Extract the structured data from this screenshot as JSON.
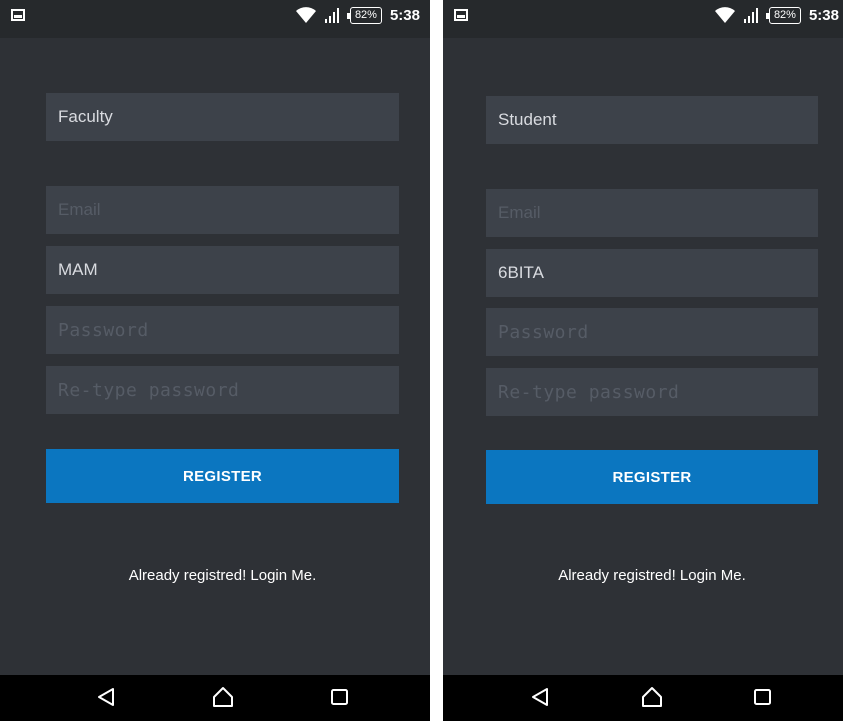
{
  "status_bar": {
    "battery": "82%",
    "time": "5:38"
  },
  "screens": [
    {
      "role_value": "Faculty",
      "email_placeholder": "Email",
      "name_value": "MAM",
      "password_placeholder": "Password",
      "retype_placeholder": "Re-type password",
      "register_label": "REGISTER",
      "login_link": "Already registred! Login Me."
    },
    {
      "role_value": "Student",
      "email_placeholder": "Email",
      "name_value": "6BITA",
      "password_placeholder": "Password",
      "retype_placeholder": "Re-type password",
      "register_label": "REGISTER",
      "login_link": "Already registred! Login Me."
    }
  ],
  "icons": {
    "status": [
      "image-notification-icon",
      "wifi-icon",
      "signal-icon",
      "battery-icon"
    ],
    "nav": [
      "back-icon",
      "home-icon",
      "recents-icon"
    ]
  },
  "colors": {
    "background": "#2e3136",
    "field": "#3d424a",
    "button": "#0b76c0",
    "nav_bar": "#000000"
  }
}
